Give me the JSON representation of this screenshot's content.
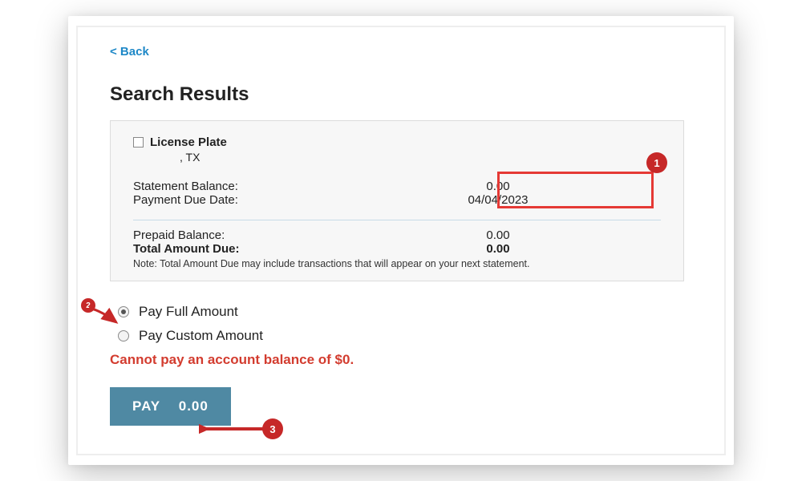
{
  "nav": {
    "back_label": "< Back"
  },
  "page_title": "Search Results",
  "account": {
    "checkbox_label": "License Plate",
    "region": ", TX"
  },
  "balance": {
    "statement_label": "Statement Balance:",
    "statement_value": "0.00",
    "due_date_label": "Payment Due Date:",
    "due_date_value": "04/04/2023",
    "prepaid_label": "Prepaid Balance:",
    "prepaid_value": "0.00",
    "total_due_label": "Total Amount Due:",
    "total_due_value": "0.00",
    "note": "Note: Total Amount Due may include transactions that will appear on your next statement."
  },
  "payment": {
    "full_label": "Pay Full Amount",
    "custom_label": "Pay Custom Amount",
    "error": "Cannot pay an account balance of $0.",
    "pay_button_prefix": "PAY",
    "pay_button_amount": "0.00"
  },
  "annotations": {
    "a1": "1",
    "a2": "2",
    "a3": "3"
  }
}
